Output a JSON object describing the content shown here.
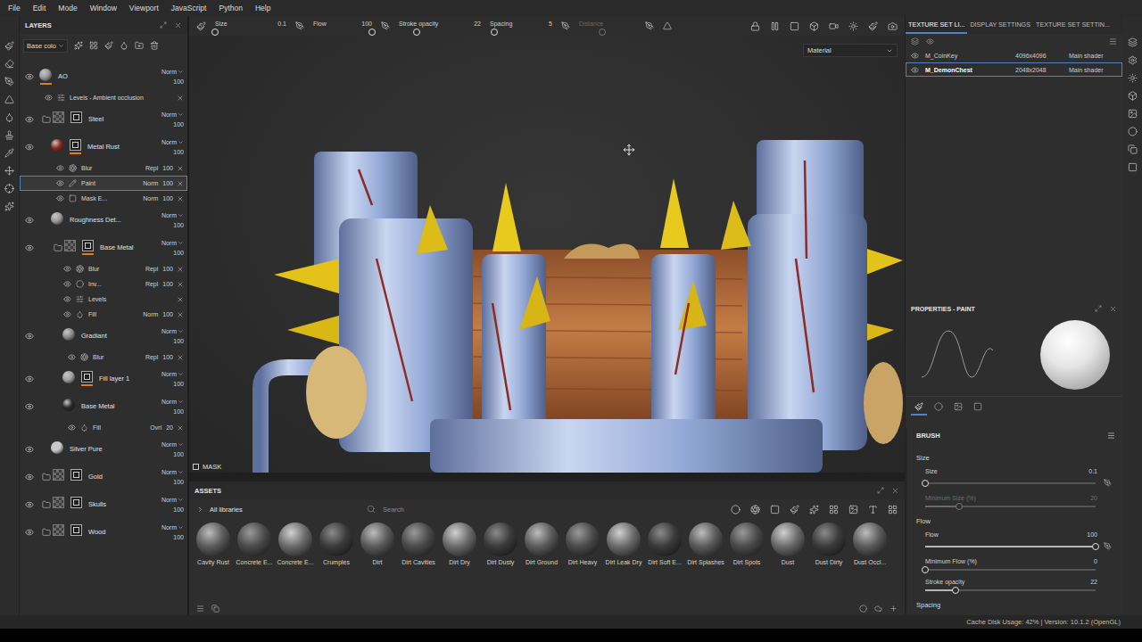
{
  "menu": [
    "File",
    "Edit",
    "Mode",
    "Window",
    "Viewport",
    "JavaScript",
    "Python",
    "Help"
  ],
  "layers": {
    "title": "LAYERS",
    "channel": "Base colo",
    "items": [
      {
        "name": "AO",
        "blend": "Norm",
        "opacity": "100",
        "visible": true,
        "depth": 0,
        "folder": false,
        "thumb": "#9a9a9a",
        "mask": false,
        "marker": true,
        "sub": [
          {
            "name": "Levels - Ambient occlusion",
            "kind": "levels",
            "visible": true,
            "selected": false
          }
        ]
      },
      {
        "name": "Steel",
        "blend": "Norm",
        "opacity": "100",
        "visible": true,
        "depth": 0,
        "folder": true,
        "thumb": "#6a6a6a",
        "mask": true,
        "marker": false,
        "sub": []
      },
      {
        "name": "Metal Rust",
        "blend": "Norm",
        "opacity": "100",
        "visible": true,
        "depth": 1,
        "folder": false,
        "thumb": "#8e2a1f",
        "mask": true,
        "marker": true,
        "sub": [
          {
            "name": "Blur",
            "kind": "blur",
            "blend": "Repl",
            "opacity": "100",
            "visible": true,
            "selected": false
          },
          {
            "name": "Paint",
            "kind": "paint",
            "blend": "Norm",
            "opacity": "100",
            "visible": true,
            "selected": true
          },
          {
            "name": "Mask E...",
            "kind": "mask",
            "blend": "Norm",
            "opacity": "100",
            "visible": true,
            "selected": false
          }
        ]
      },
      {
        "name": "Roughness Det...",
        "blend": "Norm",
        "opacity": "100",
        "visible": true,
        "depth": 1,
        "folder": false,
        "thumb": "#9a9a9a",
        "mask": false,
        "marker": false,
        "sub": []
      },
      {
        "name": "Base Metal",
        "blend": "Norm",
        "opacity": "100",
        "visible": true,
        "depth": 1,
        "folder": true,
        "thumb": "#6a6a6a",
        "mask": true,
        "marker": true,
        "sub": [
          {
            "name": "Blur",
            "kind": "blur",
            "blend": "Repl",
            "opacity": "100",
            "visible": true,
            "selected": false
          },
          {
            "name": "Inv...",
            "kind": "invert",
            "blend": "Repl",
            "opacity": "100",
            "visible": true,
            "selected": false
          },
          {
            "name": "Levels",
            "kind": "levels",
            "visible": true,
            "selected": false
          },
          {
            "name": "Fill",
            "kind": "fill",
            "blend": "Norm",
            "opacity": "100",
            "visible": true,
            "selected": false
          }
        ]
      },
      {
        "name": "Gradiant",
        "blend": "Norm",
        "opacity": "100",
        "visible": true,
        "depth": 2,
        "folder": false,
        "thumb": "#8a8a8a",
        "mask": false,
        "marker": false,
        "sub": [
          {
            "name": "Blur",
            "kind": "blur",
            "blend": "Repl",
            "opacity": "100",
            "visible": true,
            "selected": false
          }
        ]
      },
      {
        "name": "Fill layer 1",
        "blend": "Norm",
        "opacity": "100",
        "visible": true,
        "depth": 2,
        "folder": false,
        "thumb": "#a0a0a0",
        "mask": true,
        "marker": true,
        "sub": []
      },
      {
        "name": "Base Metal",
        "blend": "Norm",
        "opacity": "100",
        "visible": true,
        "depth": 2,
        "folder": false,
        "thumb": "#2a2a2a",
        "mask": false,
        "marker": false,
        "sub": [
          {
            "name": "Fill",
            "kind": "fill",
            "blend": "Ovrl",
            "opacity": "20",
            "visible": true,
            "selected": false
          }
        ]
      },
      {
        "name": "Silver Pure",
        "blend": "Norm",
        "opacity": "100",
        "visible": true,
        "depth": 1,
        "folder": false,
        "thumb": "#c8c8c8",
        "mask": false,
        "marker": false,
        "sub": []
      },
      {
        "name": "Gold",
        "blend": "Norm",
        "opacity": "100",
        "visible": true,
        "depth": 0,
        "folder": true,
        "thumb": "#6a6a6a",
        "mask": true,
        "marker": false,
        "sub": []
      },
      {
        "name": "Skulls",
        "blend": "Norm",
        "opacity": "100",
        "visible": true,
        "depth": 0,
        "folder": true,
        "thumb": "#6a6a6a",
        "mask": true,
        "marker": false,
        "sub": []
      },
      {
        "name": "Wood",
        "blend": "Norm",
        "opacity": "100",
        "visible": true,
        "depth": 0,
        "folder": true,
        "thumb": "#6a6a6a",
        "mask": true,
        "marker": false,
        "sub": []
      }
    ]
  },
  "brush_bar": {
    "params": [
      {
        "label": "Size",
        "value": "0.1",
        "level": 0.0,
        "disabled": false
      },
      {
        "label": "Flow",
        "value": "100",
        "level": 1.0,
        "disabled": false
      },
      {
        "label": "Stroke opacity",
        "value": "22",
        "level": 0.22,
        "disabled": false
      },
      {
        "label": "Spacing",
        "value": "5",
        "level": 0.07,
        "disabled": false
      },
      {
        "label": "Distance",
        "level": 0.4,
        "disabled": true
      }
    ]
  },
  "viewport": {
    "mode": "Material",
    "mask_label": "MASK"
  },
  "assets": {
    "title": "ASSETS",
    "library": "All libraries",
    "search_placeholder": "Search",
    "items": [
      "Cavity Rust",
      "Concrete E...",
      "Concrete E...",
      "Crumples",
      "Dirt",
      "Dirt Cavities",
      "Dirt Dry",
      "Dirt Dusty",
      "Dirt Ground",
      "Dirt Heavy",
      "Dirt Leak Dry",
      "Dirt Soft E...",
      "Dirt Splashes",
      "Dirt Spots",
      "Dust",
      "Dust Dirty",
      "Dust Occl..."
    ]
  },
  "right_panel": {
    "tabs": [
      {
        "label": "TEXTURE SET LI...",
        "selected": true
      },
      {
        "label": "DISPLAY SETTINGS",
        "selected": false
      },
      {
        "label": "TEXTURE SET SETTIN...",
        "selected": false
      }
    ],
    "texture_sets": [
      {
        "name": "M_CoinKey",
        "resolution": "4096x4096",
        "shader": "Main shader",
        "visible": true,
        "selected": false
      },
      {
        "name": "M_DemonChest",
        "resolution": "2048x2048",
        "shader": "Main shader",
        "visible": true,
        "selected": true
      }
    ],
    "properties_title": "PROPERTIES - PAINT",
    "tool_tabs": [
      {
        "kind": "brush",
        "selected": true
      },
      {
        "kind": "material",
        "selected": false
      },
      {
        "kind": "stencil",
        "selected": false
      },
      {
        "kind": "alpha",
        "selected": false
      }
    ],
    "brush": {
      "title": "BRUSH",
      "rows": [
        {
          "kind": "heading",
          "label": "Size"
        },
        {
          "kind": "slider",
          "label": "Size",
          "value": "0.1",
          "level": 0.0,
          "disabled": false,
          "pressure": true
        },
        {
          "kind": "slider",
          "label": "Minimum Size (%)",
          "value": "20",
          "level": 0.2,
          "disabled": true,
          "pressure": false
        },
        {
          "kind": "heading",
          "label": "Flow"
        },
        {
          "kind": "slider",
          "label": "Flow",
          "value": "100",
          "level": 1.0,
          "disabled": false,
          "pressure": true
        },
        {
          "kind": "slider",
          "label": "Minimum Flow (%)",
          "value": "0",
          "level": 0.0,
          "disabled": false,
          "pressure": false
        },
        {
          "kind": "slider",
          "label": "Stroke opacity",
          "value": "22",
          "level": 0.18,
          "disabled": false,
          "pressure": false
        },
        {
          "kind": "heading",
          "label": "Spacing"
        }
      ]
    }
  },
  "status_bar": "Cache Disk Usage: 42% | Version: 10.1.2 (OpenGL)"
}
